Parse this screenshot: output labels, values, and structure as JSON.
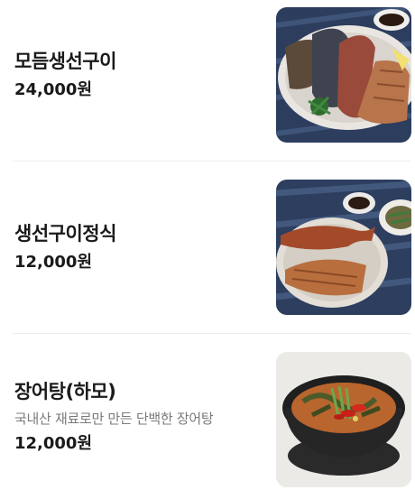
{
  "menu": {
    "items": [
      {
        "name": "모듬생선구이",
        "description": "",
        "price": "24,000원",
        "image": "grilled-assorted-fish-photo"
      },
      {
        "name": "생선구이정식",
        "description": "",
        "price": "12,000원",
        "image": "grilled-fish-set-meal-photo"
      },
      {
        "name": "장어탕(하모)",
        "description": "국내산 재료로만 만든 단백한 장어탕",
        "price": "12,000원",
        "image": "eel-soup-photo"
      }
    ]
  },
  "colors": {
    "text_primary": "#1a1a1a",
    "text_secondary": "#7a7a7a",
    "divider": "#ececec",
    "background": "#ffffff"
  }
}
